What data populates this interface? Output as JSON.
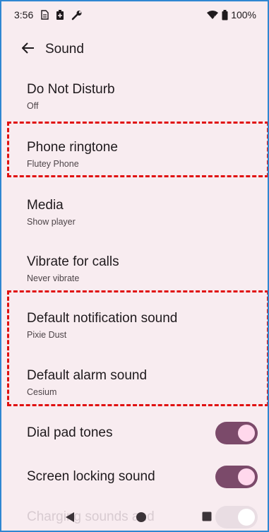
{
  "status_bar": {
    "time": "3:56",
    "icons_left": [
      "sim-icon",
      "battery-saver-icon",
      "wrench-icon"
    ],
    "battery": "100%",
    "icons_right": [
      "wifi-icon",
      "battery-icon"
    ]
  },
  "app_bar": {
    "title": "Sound",
    "back_icon": "arrow-back-icon"
  },
  "preferences": [
    {
      "title": "Do Not Disturb",
      "summary": "Off"
    },
    {
      "title": "Phone ringtone",
      "summary": "Flutey Phone"
    },
    {
      "title": "Media",
      "summary": "Show player"
    },
    {
      "title": "Vibrate for calls",
      "summary": "Never vibrate"
    },
    {
      "title": "Default notification sound",
      "summary": "Pixie Dust"
    },
    {
      "title": "Default alarm sound",
      "summary": "Cesium"
    }
  ],
  "toggles": [
    {
      "title": "Dial pad tones",
      "on": true
    },
    {
      "title": "Screen locking sound",
      "on": true
    },
    {
      "title": "Charging sounds and",
      "on": true
    }
  ],
  "nav_bar": {
    "back": "triangle-back-icon",
    "home": "circle-home-icon",
    "recents": "square-recents-icon"
  },
  "colors": {
    "background": "#f8ecf0",
    "switch_track": "#7b4a6a",
    "switch_thumb": "#ffd8ec",
    "highlight": "#e01010"
  }
}
